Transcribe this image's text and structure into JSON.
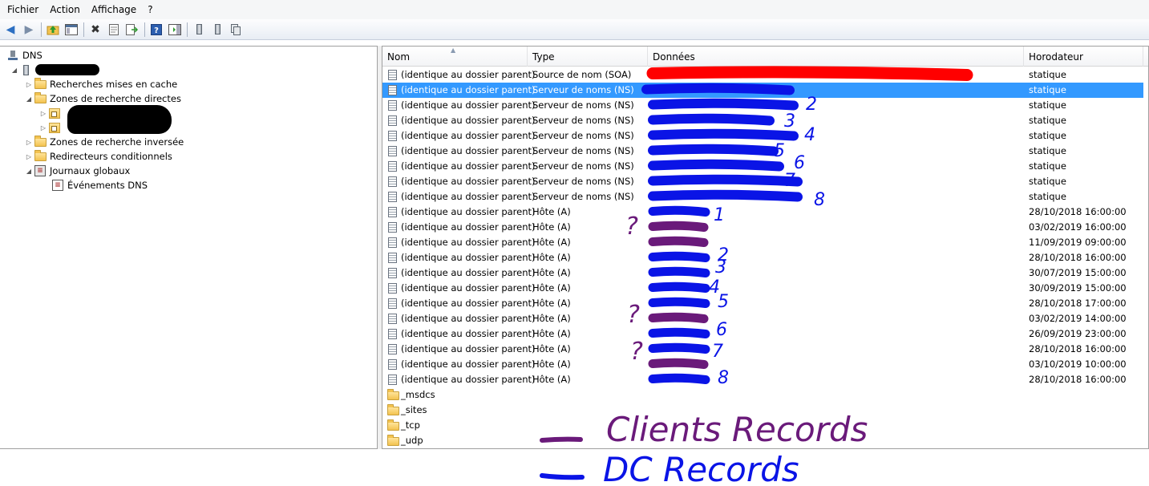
{
  "menu": [
    "Fichier",
    "Action",
    "Affichage",
    "?"
  ],
  "toolbar_icons": [
    "back-arrow-icon",
    "forward-arrow-icon",
    "up-folder-icon",
    "show-hide-tree-icon",
    "delete-icon",
    "properties-icon",
    "export-list-icon",
    "help-icon",
    "action-pane-icon",
    "server-icon",
    "server-stack-icon",
    "server-copy-icon"
  ],
  "tree": {
    "root_label": "DNS",
    "items": [
      {
        "label": "Recherches mises en cache"
      },
      {
        "label": "Zones de recherche directes"
      },
      {
        "label": "Zones de recherche inversée"
      },
      {
        "label": "Redirecteurs conditionnels"
      },
      {
        "label": "Journaux globaux"
      },
      {
        "label": "Événements DNS"
      }
    ]
  },
  "columns": {
    "name": "Nom",
    "type": "Type",
    "data": "Données",
    "timestamp": "Horodateur"
  },
  "records": [
    {
      "name": "(identique au dossier parent)",
      "type": "Source de nom (SOA)",
      "data": "",
      "timestamp": "statique"
    },
    {
      "name": "(identique au dossier parent)",
      "type": "Serveur de noms (NS)",
      "data": "",
      "timestamp": "statique"
    },
    {
      "name": "(identique au dossier parent)",
      "type": "Serveur de noms (NS)",
      "data": "",
      "timestamp": "statique"
    },
    {
      "name": "(identique au dossier parent)",
      "type": "Serveur de noms (NS)",
      "data": "",
      "timestamp": "statique"
    },
    {
      "name": "(identique au dossier parent)",
      "type": "Serveur de noms (NS)",
      "data": "",
      "timestamp": "statique"
    },
    {
      "name": "(identique au dossier parent)",
      "type": "Serveur de noms (NS)",
      "data": "",
      "timestamp": "statique"
    },
    {
      "name": "(identique au dossier parent)",
      "type": "Serveur de noms (NS)",
      "data": "",
      "timestamp": "statique"
    },
    {
      "name": "(identique au dossier parent)",
      "type": "Serveur de noms (NS)",
      "data": "",
      "timestamp": "statique"
    },
    {
      "name": "(identique au dossier parent)",
      "type": "Serveur de noms (NS)",
      "data": "",
      "timestamp": "statique"
    },
    {
      "name": "(identique au dossier parent)",
      "type": "Hôte (A)",
      "data": "",
      "timestamp": "28/10/2018 16:00:00"
    },
    {
      "name": "(identique au dossier parent)",
      "type": "Hôte (A)",
      "data": "",
      "timestamp": "03/02/2019 16:00:00"
    },
    {
      "name": "(identique au dossier parent)",
      "type": "Hôte (A)",
      "data": "",
      "timestamp": "11/09/2019 09:00:00"
    },
    {
      "name": "(identique au dossier parent)",
      "type": "Hôte (A)",
      "data": "",
      "timestamp": "28/10/2018 16:00:00"
    },
    {
      "name": "(identique au dossier parent)",
      "type": "Hôte (A)",
      "data": "",
      "timestamp": "30/07/2019 15:00:00"
    },
    {
      "name": "(identique au dossier parent)",
      "type": "Hôte (A)",
      "data": "",
      "timestamp": "30/09/2019 15:00:00"
    },
    {
      "name": "(identique au dossier parent)",
      "type": "Hôte (A)",
      "data": "",
      "timestamp": "28/10/2018 17:00:00"
    },
    {
      "name": "(identique au dossier parent)",
      "type": "Hôte (A)",
      "data": "",
      "timestamp": "03/02/2019 14:00:00"
    },
    {
      "name": "(identique au dossier parent)",
      "type": "Hôte (A)",
      "data": "",
      "timestamp": "26/09/2019 23:00:00"
    },
    {
      "name": "(identique au dossier parent)",
      "type": "Hôte (A)",
      "data": "",
      "timestamp": "28/10/2018 16:00:00"
    },
    {
      "name": "(identique au dossier parent)",
      "type": "Hôte (A)",
      "data": "",
      "timestamp": "03/10/2019 10:00:00"
    },
    {
      "name": "(identique au dossier parent)",
      "type": "Hôte (A)",
      "data": "",
      "timestamp": "28/10/2018 16:00:00"
    }
  ],
  "folders": [
    "_msdcs",
    "_sites",
    "_tcp",
    "_udp"
  ],
  "annotations": {
    "legend_clients": "Clients Records",
    "legend_dc": "DC Records",
    "ns_numbers": [
      "2",
      "3",
      "4",
      "5",
      "6",
      "7",
      "8"
    ],
    "host_numbers": [
      "1",
      "2",
      "3",
      "4",
      "5",
      "6",
      "7",
      "8"
    ],
    "question_mark": "?",
    "color_clients": "#6a1a7a",
    "color_dc": "#0a14e6",
    "color_soa": "#ff0000",
    "color_selected": "#3399ff"
  }
}
